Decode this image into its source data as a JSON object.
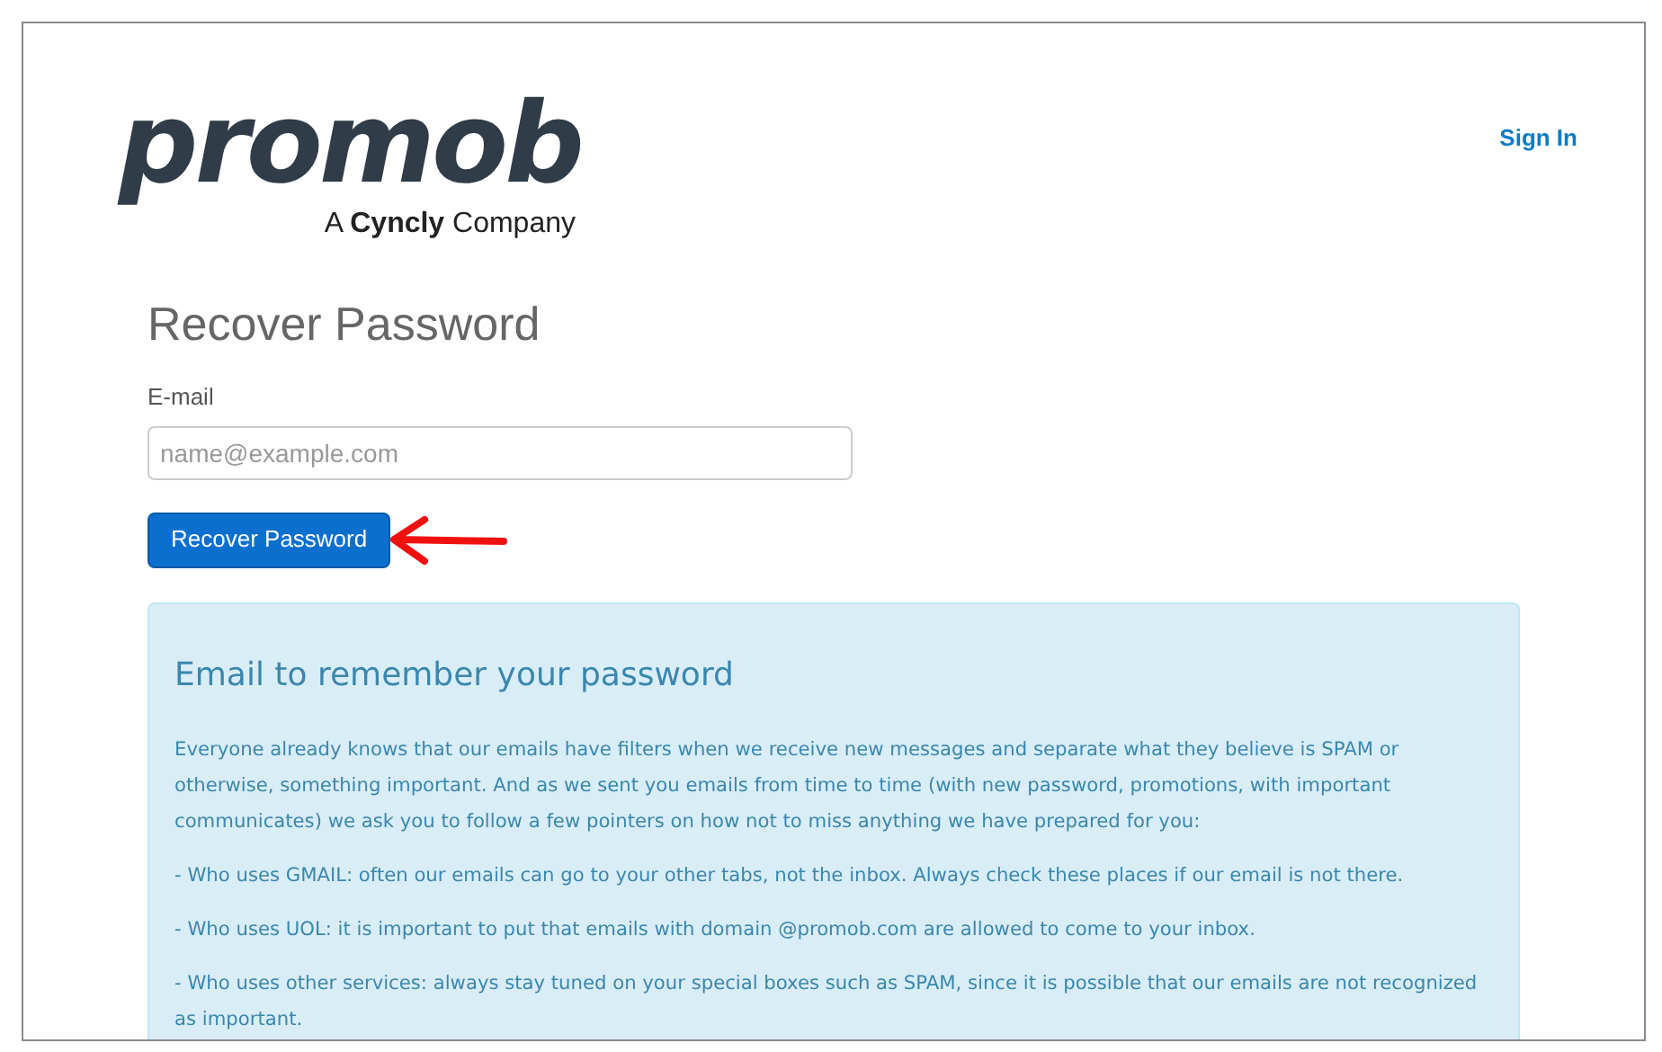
{
  "logo": {
    "wordmark": "promob",
    "tagline": "A **Cyncly** Company"
  },
  "header": {
    "sign_in_link": "Sign In"
  },
  "form": {
    "title": "Recover Password",
    "email_label": "E-mail",
    "email_placeholder": "name@example.com",
    "submit_button": "Recover Password"
  },
  "info_panel": {
    "title": "Email to remember your password",
    "paragraphs": [
      "Everyone already knows that our emails have filters when we receive new messages and separate what they believe is SPAM or otherwise, something important. And as we sent you emails from time to time (with new password, promotions, with important communicates) we ask you to follow a few pointers on how not to miss anything we have prepared for you:",
      "- Who uses GMAIL: often our emails can go to your other tabs, not the inbox. Always check these places if our email is not there.",
      "- Who uses UOL: it is important to put that emails with domain @promob.com are allowed to come to your inbox.",
      "- Who uses other services: always stay tuned on your special boxes such as SPAM, since it is possible that our emails are not recognized as important."
    ]
  }
}
